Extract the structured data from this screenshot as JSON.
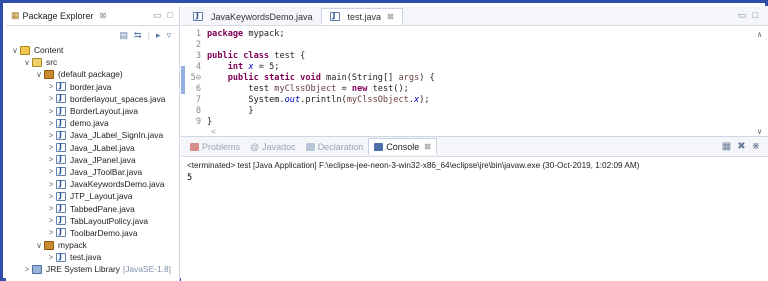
{
  "package_explorer": {
    "title": "Package Explorer",
    "close_glyph": "⊠",
    "tree": [
      {
        "label": "Content",
        "twisty": "∨",
        "icon": "project",
        "indent": 0
      },
      {
        "label": "src",
        "twisty": "∨",
        "icon": "src",
        "indent": 1
      },
      {
        "label": "(default package)",
        "twisty": "∨",
        "icon": "package",
        "indent": 2
      },
      {
        "label": "border.java",
        "twisty": ">",
        "icon": "java",
        "indent": 3
      },
      {
        "label": "borderlayout_spaces.java",
        "twisty": ">",
        "icon": "java",
        "indent": 3
      },
      {
        "label": "BorderLayout.java",
        "twisty": ">",
        "icon": "java",
        "indent": 3
      },
      {
        "label": "demo.java",
        "twisty": ">",
        "icon": "java",
        "indent": 3
      },
      {
        "label": "Java_JLabel_SignIn.java",
        "twisty": ">",
        "icon": "java",
        "indent": 3
      },
      {
        "label": "Java_JLabel.java",
        "twisty": ">",
        "icon": "java",
        "indent": 3
      },
      {
        "label": "Java_JPanel.java",
        "twisty": ">",
        "icon": "java",
        "indent": 3
      },
      {
        "label": "Java_JToolBar.java",
        "twisty": ">",
        "icon": "java",
        "indent": 3
      },
      {
        "label": "JavaKeywordsDemo.java",
        "twisty": ">",
        "icon": "java",
        "indent": 3
      },
      {
        "label": "JTP_Layout.java",
        "twisty": ">",
        "icon": "java",
        "indent": 3
      },
      {
        "label": "TabbedPane.java",
        "twisty": ">",
        "icon": "java",
        "indent": 3
      },
      {
        "label": "TabLayoutPolicy.java",
        "twisty": ">",
        "icon": "java",
        "indent": 3
      },
      {
        "label": "ToolbarDemo.java",
        "twisty": ">",
        "icon": "java",
        "indent": 3
      },
      {
        "label": "mypack",
        "twisty": "∨",
        "icon": "package",
        "indent": 2
      },
      {
        "label": "test.java",
        "twisty": ">",
        "icon": "java",
        "indent": 3
      },
      {
        "label": "JRE System Library",
        "suffix": "[JavaSE-1.8]",
        "twisty": ">",
        "icon": "library",
        "indent": 1
      }
    ]
  },
  "editor": {
    "tabs": [
      {
        "label": "JavaKeywordsDemo.java",
        "active": false
      },
      {
        "label": "test.java",
        "active": true
      }
    ],
    "close_glyph": "⊠",
    "lines": [
      {
        "num": "1",
        "code": "package mypack;"
      },
      {
        "num": "2",
        "code": ""
      },
      {
        "num": "3",
        "code": "public class test {"
      },
      {
        "num": "4",
        "code": "    int x = 5;"
      },
      {
        "num": "5⊖",
        "code": "    public static void main(String[] args) {"
      },
      {
        "num": "6",
        "code": "        test myClssObject = new test();"
      },
      {
        "num": "7",
        "code": "        System.out.println(myClssObject.x);"
      },
      {
        "num": "8",
        "code": "        }"
      },
      {
        "num": "9",
        "code": "}"
      }
    ]
  },
  "console": {
    "tabs": [
      {
        "label": "Problems",
        "icon_color": "#d98c8c"
      },
      {
        "label": "Javadoc",
        "prefix": "@",
        "icon_color": ""
      },
      {
        "label": "Declaration",
        "icon_color": "#b8c4d8"
      },
      {
        "label": "Console",
        "icon_color": "#4a6fa8",
        "active": true
      }
    ],
    "close_glyph": "⊠",
    "terminated_line": "<terminated> test [Java Application] F:\\eclipse-jee-neon-3-win32-x86_64\\eclipse\\jre\\bin\\javaw.exe (30-Oct-2019, 1:02:09 AM)",
    "output": "5"
  },
  "colors": {
    "frame_border": "#2e4ea8",
    "keyword": "#7f0055",
    "field": "#0000c0"
  }
}
